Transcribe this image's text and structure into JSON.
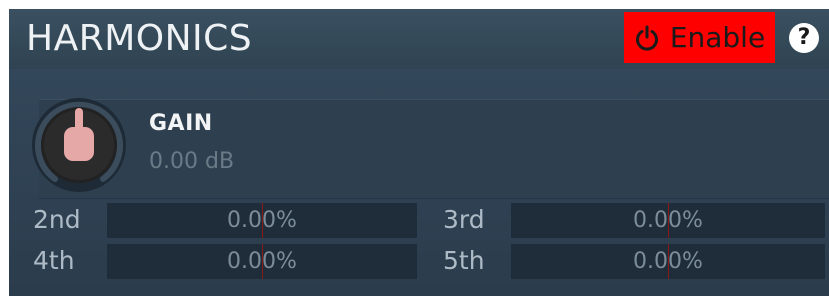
{
  "panel": {
    "title": "HARMONICS",
    "enable_label": "Enable",
    "help_label": "?"
  },
  "gain": {
    "name": "GAIN",
    "value": "0.00 dB"
  },
  "harmonics": [
    {
      "label": "2nd",
      "value": "0.00%"
    },
    {
      "label": "3rd",
      "value": "0.00%"
    },
    {
      "label": "4th",
      "value": "0.00%"
    },
    {
      "label": "5th",
      "value": "0.00%"
    }
  ],
  "colors": {
    "enable_bg": "#ff0000",
    "panel_bg": "#2a3a48",
    "knob_cap": "#e6a7a7",
    "slider_center_line": "#8a1a1a"
  },
  "icons": {
    "enable": "power-icon",
    "help": "help-icon"
  }
}
